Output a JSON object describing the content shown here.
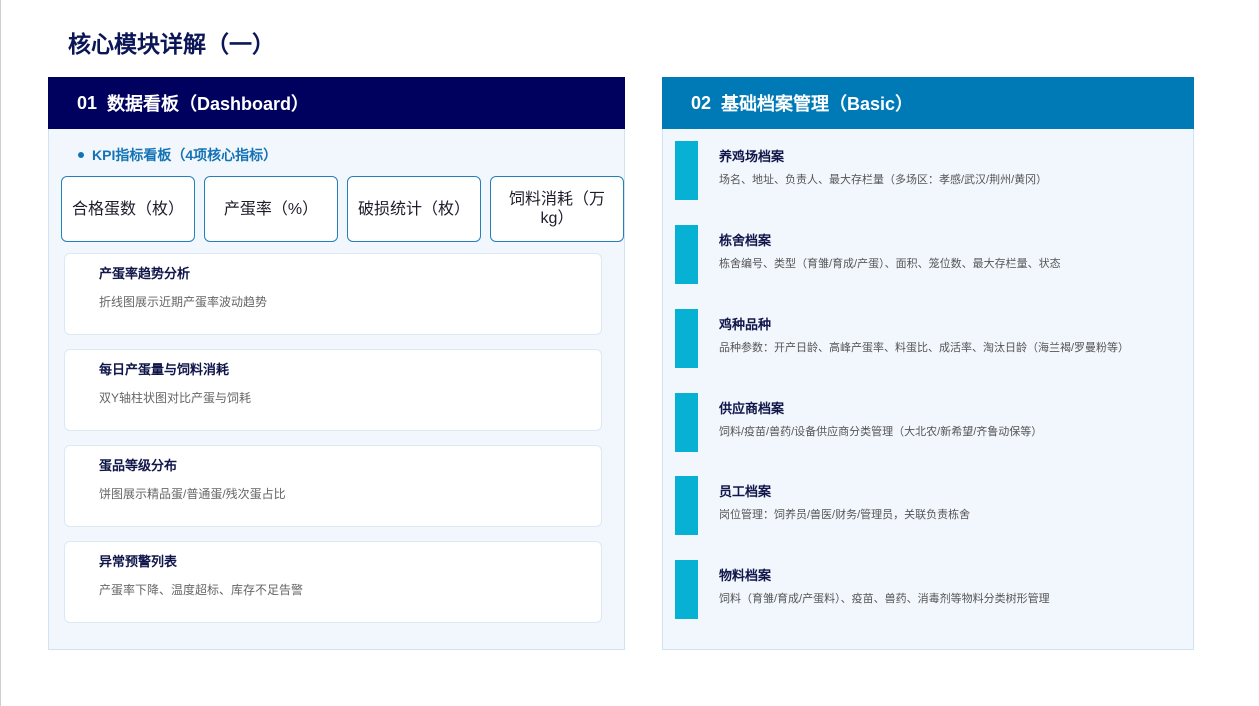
{
  "page": {
    "title": "核心模块详解（一）"
  },
  "colors": {
    "dashboard_header": "#00005f",
    "basic_header": "#007ab7",
    "accent_bar": "#06b1d4",
    "kpi_border": "#2381ba",
    "title_text": "#0b1657"
  },
  "dashboard": {
    "number": "01",
    "label": "数据看板（Dashboard）",
    "kpi_title": "KPI指标看板（4项核心指标）",
    "kpis": [
      "合格蛋数（枚）",
      "产蛋率（%）",
      "破损统计（枚）",
      "饲料消耗（万kg）"
    ],
    "cards": [
      {
        "title": "产蛋率趋势分析",
        "desc": "折线图展示近期产蛋率波动趋势"
      },
      {
        "title": "每日产蛋量与饲料消耗",
        "desc": "双Y轴柱状图对比产蛋与饲耗"
      },
      {
        "title": "蛋品等级分布",
        "desc": "饼图展示精品蛋/普通蛋/残次蛋占比"
      },
      {
        "title": "异常预警列表",
        "desc": "产蛋率下降、温度超标、库存不足告警"
      }
    ]
  },
  "basic": {
    "number": "02",
    "label": "基础档案管理（Basic）",
    "items": [
      {
        "title": "养鸡场档案",
        "desc": "场名、地址、负责人、最大存栏量（多场区：孝感/武汉/荆州/黄冈）"
      },
      {
        "title": "栋舍档案",
        "desc": "栋舍编号、类型（育雏/育成/产蛋）、面积、笼位数、最大存栏量、状态"
      },
      {
        "title": "鸡种品种",
        "desc": "品种参数：开产日龄、高峰产蛋率、料蛋比、成活率、淘汰日龄（海兰褐/罗曼粉等）"
      },
      {
        "title": "供应商档案",
        "desc": "饲料/疫苗/兽药/设备供应商分类管理（大北农/新希望/齐鲁动保等）"
      },
      {
        "title": "员工档案",
        "desc": "岗位管理：饲养员/兽医/财务/管理员，关联负责栋舍"
      },
      {
        "title": "物料档案",
        "desc": "饲料（育雏/育成/产蛋料）、疫苗、兽药、消毒剂等物料分类树形管理"
      }
    ]
  }
}
